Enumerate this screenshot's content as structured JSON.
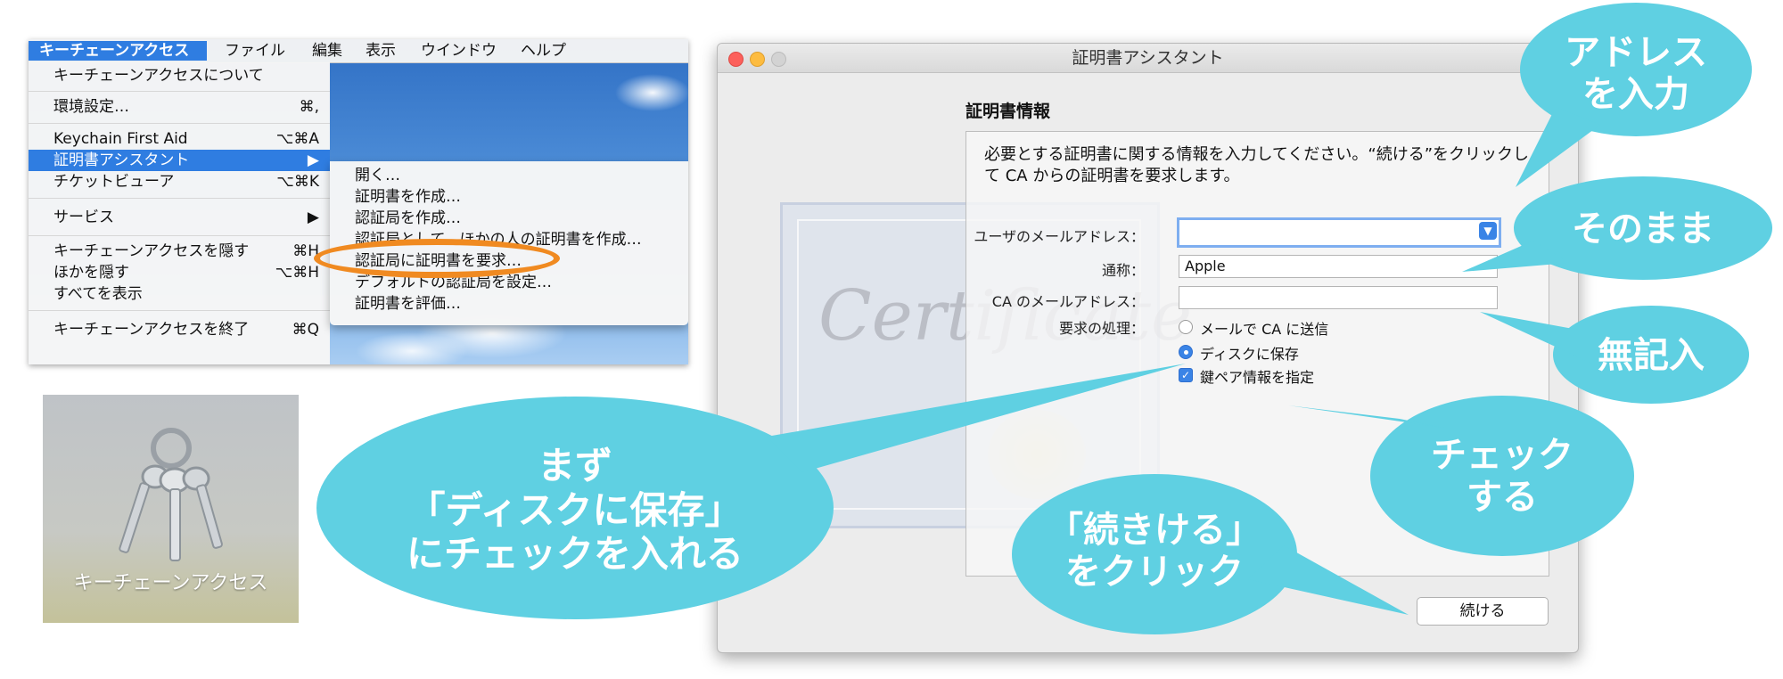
{
  "menu": {
    "bar": [
      "キーチェーンアクセス",
      "ファイル",
      "編集",
      "表示",
      "ウインドウ",
      "ヘルプ"
    ],
    "items": [
      {
        "label": "キーチェーンアクセスについて",
        "shortcut": ""
      },
      {
        "label": "環境設定…",
        "shortcut": "⌘,"
      },
      {
        "label": "Keychain First Aid",
        "shortcut": "⌥⌘A"
      },
      {
        "label": "証明書アシスタント",
        "shortcut": "▶"
      },
      {
        "label": "チケットビューア",
        "shortcut": "⌥⌘K"
      },
      {
        "label": "サービス",
        "shortcut": "▶"
      },
      {
        "label": "キーチェーンアクセスを隠す",
        "shortcut": "⌘H"
      },
      {
        "label": "ほかを隠す",
        "shortcut": "⌥⌘H"
      },
      {
        "label": "すべてを表示",
        "shortcut": ""
      },
      {
        "label": "キーチェーンアクセスを終了",
        "shortcut": "⌘Q"
      }
    ],
    "submenu": [
      "開く…",
      "証明書を作成…",
      "認証局を作成…",
      "認証局として、ほかの人の証明書を作成…",
      "認証局に証明書を要求…",
      "デフォルトの認証局を設定…",
      "証明書を評価…"
    ]
  },
  "keychain_tile": {
    "label": "キーチェーンアクセス"
  },
  "window": {
    "title": "証明書アシスタント",
    "heading": "証明書情報",
    "description": "必要とする証明書に関する情報を入力してください。“続ける”をクリックして CA からの証明書を要求します。",
    "decor_text": "Certificate",
    "fields": {
      "email_label": "ユーザのメールアドレス：",
      "email_value": "",
      "name_label": "通称：",
      "name_value": "Apple",
      "ca_email_label": "CA のメールアドレス：",
      "ca_email_value": "",
      "request_label": "要求の処理："
    },
    "options": {
      "email_ca": "メールで CA に送信",
      "save_disk": "ディスクに保存",
      "key_pair": "鍵ペア情報を指定"
    },
    "continue_button": "続ける"
  },
  "callouts": {
    "address": [
      "アドレス",
      "を入力"
    ],
    "as_is": "そのまま",
    "blank": "無記入",
    "check": [
      "チェック",
      "する"
    ],
    "continue": [
      "「続きける」",
      "をクリック"
    ],
    "first": [
      "まず",
      "「ディスクに保存」",
      "にチェックを入れる"
    ]
  },
  "colors": {
    "callout": "#5fd0e2",
    "highlight": "#f08a21",
    "menu_selection": "#2f7de1"
  }
}
